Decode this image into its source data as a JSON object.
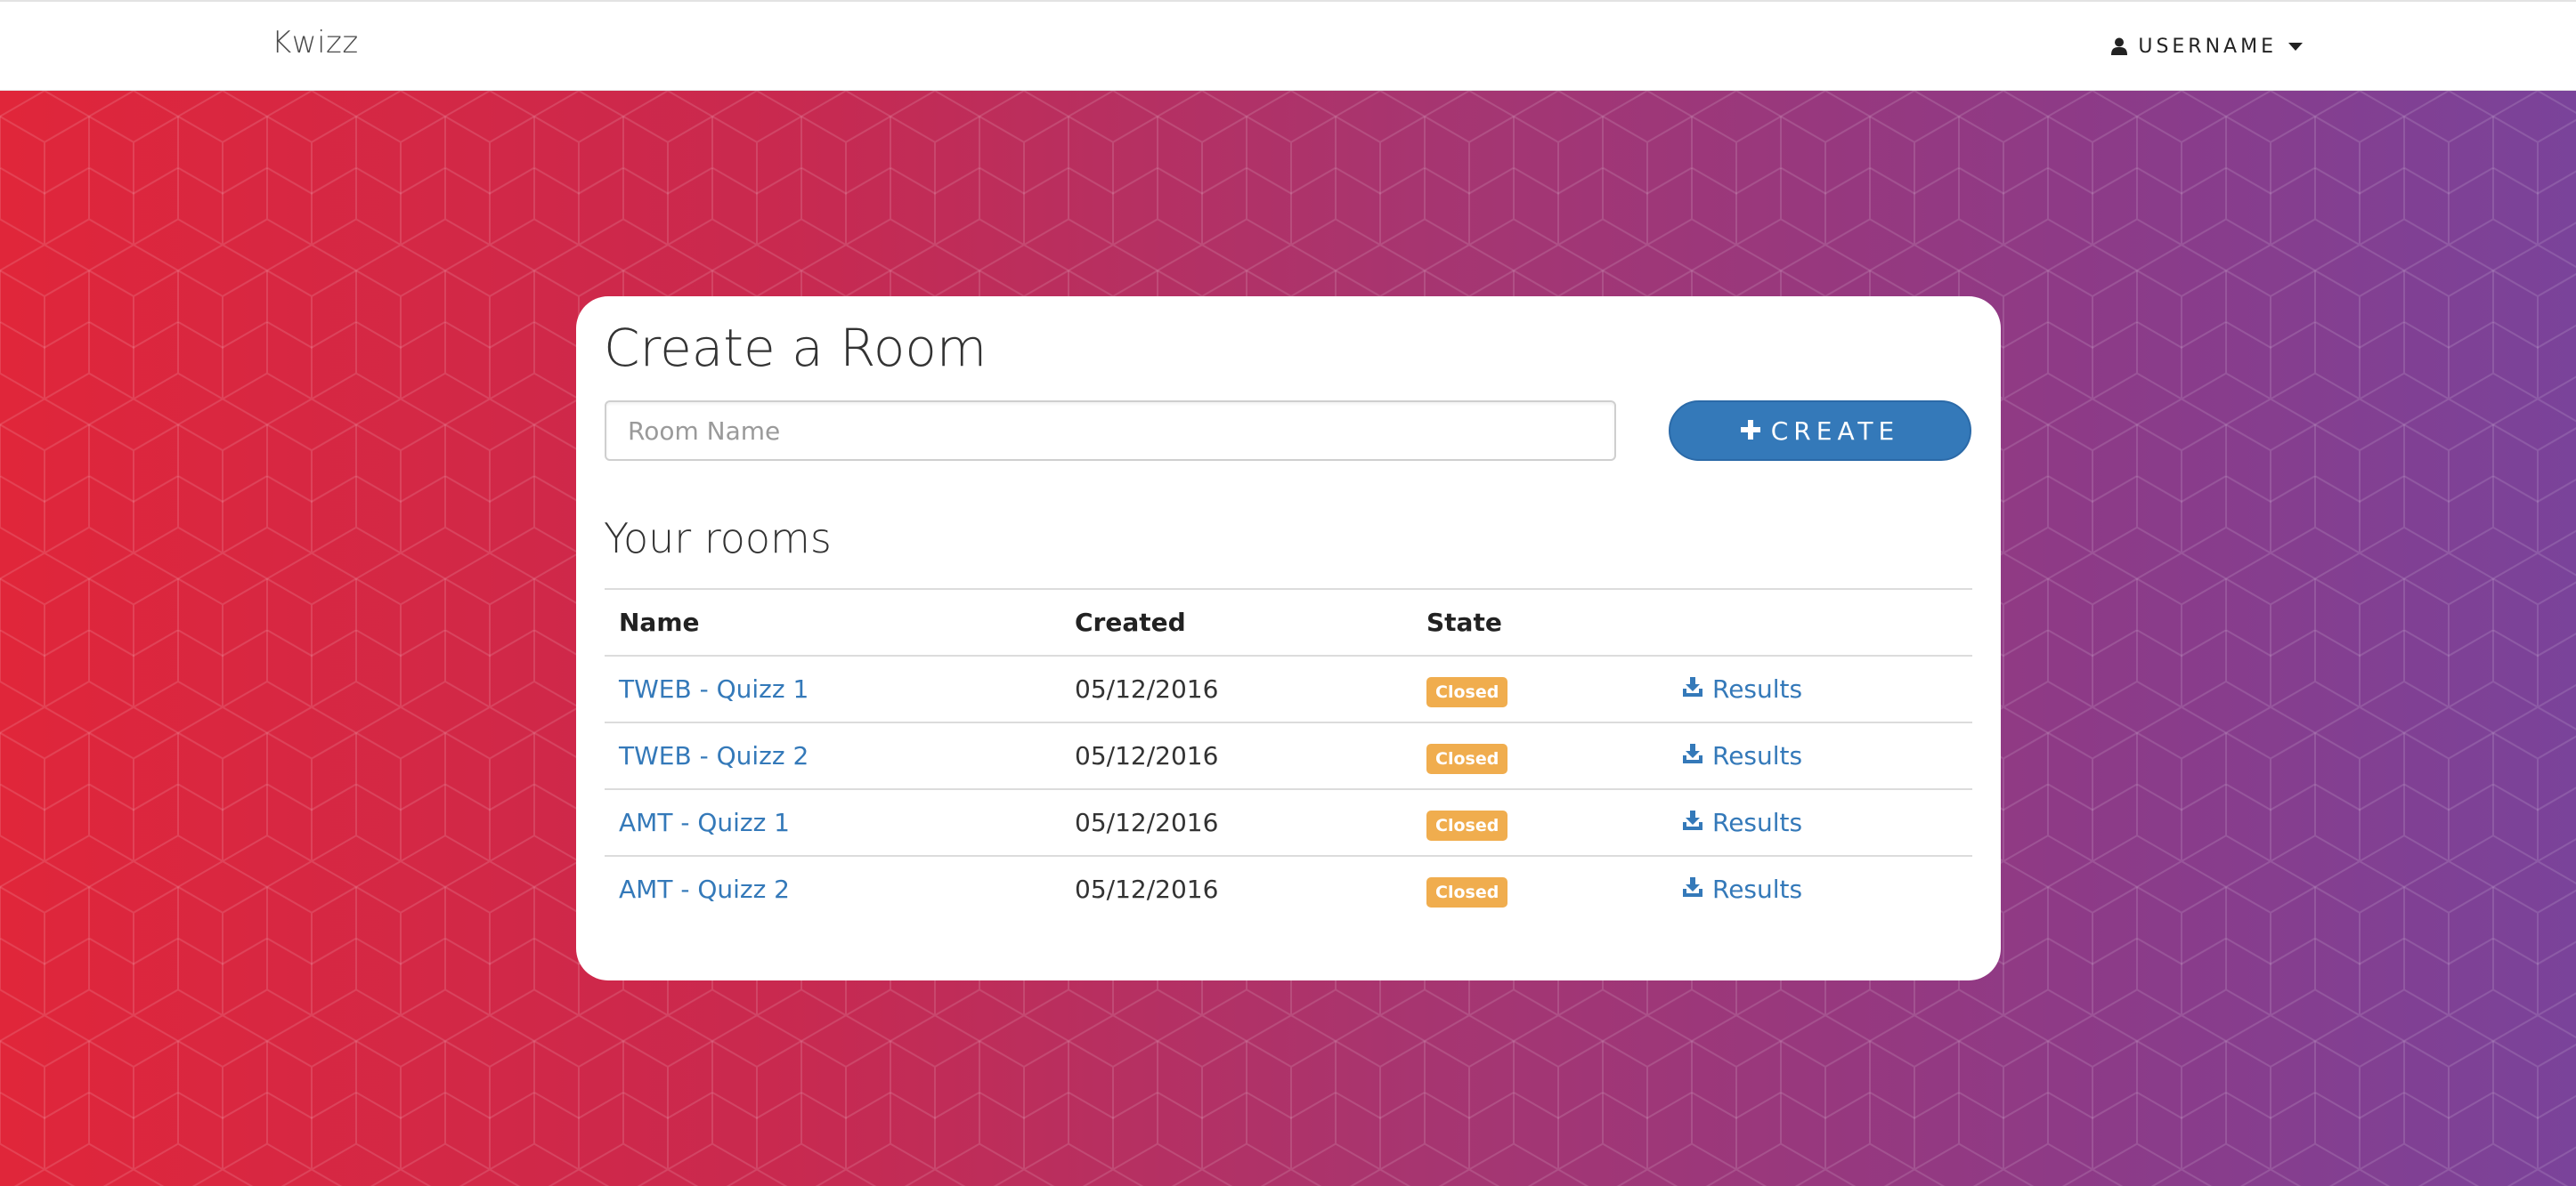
{
  "app": {
    "brand": "Kwizz"
  },
  "user_menu": {
    "label": "USERNAME",
    "icon": "user-icon",
    "caret_icon": "caret-down-icon"
  },
  "create_room": {
    "title": "Create a Room",
    "input_placeholder": "Room Name",
    "input_value": "",
    "button_label": "CREATE",
    "button_icon": "plus-icon"
  },
  "rooms": {
    "title": "Your rooms",
    "columns": [
      "Name",
      "Created",
      "State",
      ""
    ],
    "rows": [
      {
        "name": "TWEB - Quizz 1",
        "created": "05/12/2016",
        "state": "Closed",
        "action": "Results"
      },
      {
        "name": "TWEB - Quizz 2",
        "created": "05/12/2016",
        "state": "Closed",
        "action": "Results"
      },
      {
        "name": "AMT - Quizz 1",
        "created": "05/12/2016",
        "state": "Closed",
        "action": "Results"
      },
      {
        "name": "AMT - Quizz 2",
        "created": "05/12/2016",
        "state": "Closed",
        "action": "Results"
      }
    ]
  },
  "colors": {
    "accent": "#3479b9",
    "badge_closed": "#f0ad4e",
    "gradient_start": "#e0263a",
    "gradient_end": "#7a439a"
  }
}
